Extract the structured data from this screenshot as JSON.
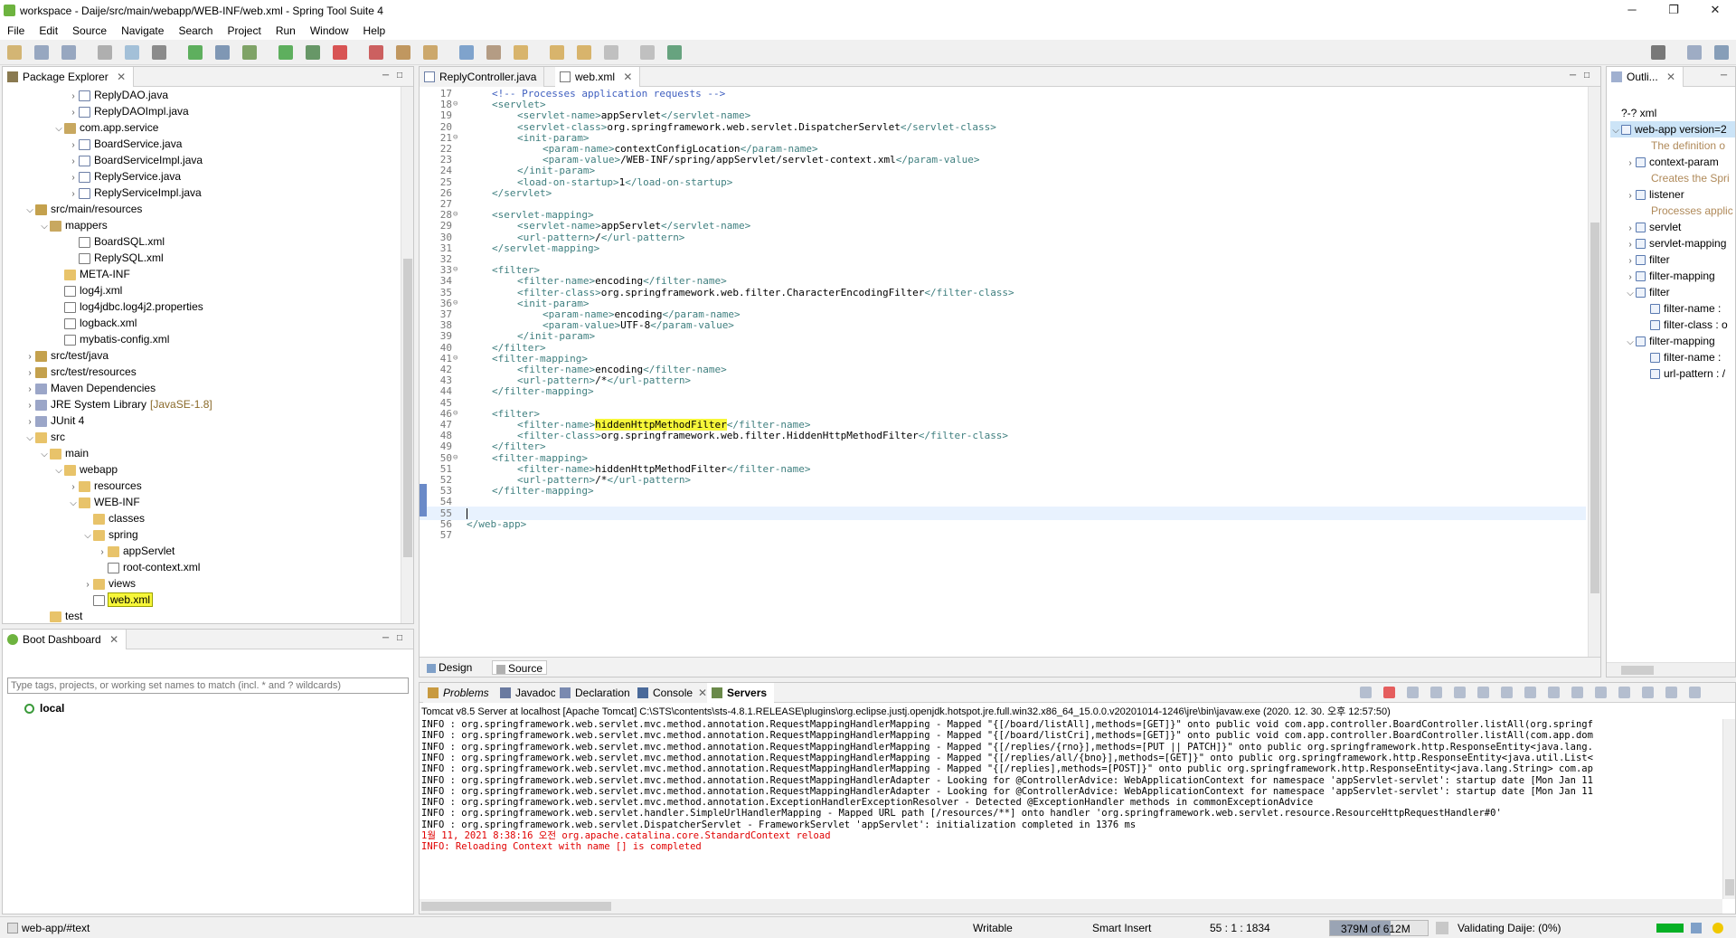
{
  "window": {
    "title": "workspace - Daije/src/main/webapp/WEB-INF/web.xml - Spring Tool Suite 4",
    "min_label": "─",
    "max_label": "❐",
    "close_label": "✕"
  },
  "menu": [
    "File",
    "Edit",
    "Source",
    "Navigate",
    "Search",
    "Project",
    "Run",
    "Window",
    "Help"
  ],
  "package_explorer": {
    "title": "Package Explorer",
    "items": [
      {
        "label": "ReplyDAO.java",
        "indent": 4,
        "twisty": ">",
        "icon": "java"
      },
      {
        "label": "ReplyDAOImpl.java",
        "indent": 4,
        "twisty": ">",
        "icon": "java"
      },
      {
        "label": "com.app.service",
        "indent": 3,
        "twisty": "v",
        "icon": "pkg"
      },
      {
        "label": "BoardService.java",
        "indent": 4,
        "twisty": ">",
        "icon": "java"
      },
      {
        "label": "BoardServiceImpl.java",
        "indent": 4,
        "twisty": ">",
        "icon": "java"
      },
      {
        "label": "ReplyService.java",
        "indent": 4,
        "twisty": ">",
        "icon": "java"
      },
      {
        "label": "ReplyServiceImpl.java",
        "indent": 4,
        "twisty": ">",
        "icon": "java"
      },
      {
        "label": "src/main/resources",
        "indent": 1,
        "twisty": "v",
        "icon": "src"
      },
      {
        "label": "mappers",
        "indent": 2,
        "twisty": "v",
        "icon": "pkg"
      },
      {
        "label": "BoardSQL.xml",
        "indent": 4,
        "twisty": "",
        "icon": "xml"
      },
      {
        "label": "ReplySQL.xml",
        "indent": 4,
        "twisty": "",
        "icon": "xml"
      },
      {
        "label": "META-INF",
        "indent": 3,
        "twisty": "",
        "icon": "folder"
      },
      {
        "label": "log4j.xml",
        "indent": 3,
        "twisty": "",
        "icon": "xml"
      },
      {
        "label": "log4jdbc.log4j2.properties",
        "indent": 3,
        "twisty": "",
        "icon": "xml"
      },
      {
        "label": "logback.xml",
        "indent": 3,
        "twisty": "",
        "icon": "xml"
      },
      {
        "label": "mybatis-config.xml",
        "indent": 3,
        "twisty": "",
        "icon": "xml"
      },
      {
        "label": "src/test/java",
        "indent": 1,
        "twisty": ">",
        "icon": "src"
      },
      {
        "label": "src/test/resources",
        "indent": 1,
        "twisty": ">",
        "icon": "src"
      },
      {
        "label": "Maven Dependencies",
        "indent": 1,
        "twisty": ">",
        "icon": "lib"
      },
      {
        "label": "JRE System Library",
        "suffix": "[JavaSE-1.8]",
        "indent": 1,
        "twisty": ">",
        "icon": "lib"
      },
      {
        "label": "JUnit 4",
        "indent": 1,
        "twisty": ">",
        "icon": "lib"
      },
      {
        "label": "src",
        "indent": 1,
        "twisty": "v",
        "icon": "folder"
      },
      {
        "label": "main",
        "indent": 2,
        "twisty": "v",
        "icon": "folder"
      },
      {
        "label": "webapp",
        "indent": 3,
        "twisty": "v",
        "icon": "folder"
      },
      {
        "label": "resources",
        "indent": 4,
        "twisty": ">",
        "icon": "folder"
      },
      {
        "label": "WEB-INF",
        "indent": 4,
        "twisty": "v",
        "icon": "folder"
      },
      {
        "label": "classes",
        "indent": 5,
        "twisty": "",
        "icon": "folder"
      },
      {
        "label": "spring",
        "indent": 5,
        "twisty": "v",
        "icon": "folder"
      },
      {
        "label": "appServlet",
        "indent": 6,
        "twisty": ">",
        "icon": "folder"
      },
      {
        "label": "root-context.xml",
        "indent": 6,
        "twisty": "",
        "icon": "xml"
      },
      {
        "label": "views",
        "indent": 5,
        "twisty": ">",
        "icon": "folder"
      },
      {
        "label": "web.xml",
        "indent": 5,
        "twisty": "",
        "icon": "xml",
        "selected": true
      },
      {
        "label": "test",
        "indent": 2,
        "twisty": "",
        "icon": "folder"
      }
    ]
  },
  "boot_dashboard": {
    "title": "Boot Dashboard",
    "search_placeholder": "Type tags, projects, or working set names to match (incl. * and ? wildcards)",
    "items": [
      "local"
    ]
  },
  "editor": {
    "tabs": [
      "ReplyController.java",
      "web.xml"
    ],
    "active_tab": 1,
    "bottom_tabs": [
      "Design",
      "Source"
    ],
    "lines": [
      {
        "n": "17",
        "fold": "",
        "indent": 1,
        "parts": [
          [
            "cmt",
            "<!-- Processes application requests -->"
          ]
        ]
      },
      {
        "n": "18",
        "fold": "⊖",
        "indent": 1,
        "parts": [
          [
            "tag",
            "<servlet>"
          ]
        ]
      },
      {
        "n": "19",
        "fold": "",
        "indent": 2,
        "parts": [
          [
            "tag",
            "<servlet-name>"
          ],
          [
            "txt",
            "appServlet"
          ],
          [
            "tag",
            "</servlet-name>"
          ]
        ]
      },
      {
        "n": "20",
        "fold": "",
        "indent": 2,
        "parts": [
          [
            "tag",
            "<servlet-class>"
          ],
          [
            "txt",
            "org.springframework.web.servlet.DispatcherServlet"
          ],
          [
            "tag",
            "</servlet-class>"
          ]
        ]
      },
      {
        "n": "21",
        "fold": "⊖",
        "indent": 2,
        "parts": [
          [
            "tag",
            "<init-param>"
          ]
        ]
      },
      {
        "n": "22",
        "fold": "",
        "indent": 3,
        "parts": [
          [
            "tag",
            "<param-name>"
          ],
          [
            "txt",
            "contextConfigLocation"
          ],
          [
            "tag",
            "</param-name>"
          ]
        ]
      },
      {
        "n": "23",
        "fold": "",
        "indent": 3,
        "parts": [
          [
            "tag",
            "<param-value>"
          ],
          [
            "txt",
            "/WEB-INF/spring/appServlet/servlet-context.xml"
          ],
          [
            "tag",
            "</param-value>"
          ]
        ]
      },
      {
        "n": "24",
        "fold": "",
        "indent": 2,
        "parts": [
          [
            "tag",
            "</init-param>"
          ]
        ]
      },
      {
        "n": "25",
        "fold": "",
        "indent": 2,
        "parts": [
          [
            "tag",
            "<load-on-startup>"
          ],
          [
            "txt",
            "1"
          ],
          [
            "tag",
            "</load-on-startup>"
          ]
        ]
      },
      {
        "n": "26",
        "fold": "",
        "indent": 1,
        "parts": [
          [
            "tag",
            "</servlet>"
          ]
        ]
      },
      {
        "n": "27",
        "fold": "",
        "indent": 0,
        "parts": []
      },
      {
        "n": "28",
        "fold": "⊖",
        "indent": 1,
        "parts": [
          [
            "tag",
            "<servlet-mapping>"
          ]
        ]
      },
      {
        "n": "29",
        "fold": "",
        "indent": 2,
        "parts": [
          [
            "tag",
            "<servlet-name>"
          ],
          [
            "txt",
            "appServlet"
          ],
          [
            "tag",
            "</servlet-name>"
          ]
        ]
      },
      {
        "n": "30",
        "fold": "",
        "indent": 2,
        "parts": [
          [
            "tag",
            "<url-pattern>"
          ],
          [
            "txt",
            "/"
          ],
          [
            "tag",
            "</url-pattern>"
          ]
        ]
      },
      {
        "n": "31",
        "fold": "",
        "indent": 1,
        "parts": [
          [
            "tag",
            "</servlet-mapping>"
          ]
        ]
      },
      {
        "n": "32",
        "fold": "",
        "indent": 0,
        "parts": []
      },
      {
        "n": "33",
        "fold": "⊖",
        "indent": 1,
        "parts": [
          [
            "tag",
            "<filter>"
          ]
        ]
      },
      {
        "n": "34",
        "fold": "",
        "indent": 2,
        "parts": [
          [
            "tag",
            "<filter-name>"
          ],
          [
            "txt",
            "encoding"
          ],
          [
            "tag",
            "</filter-name>"
          ]
        ]
      },
      {
        "n": "35",
        "fold": "",
        "indent": 2,
        "parts": [
          [
            "tag",
            "<filter-class>"
          ],
          [
            "txt",
            "org.springframework.web.filter.CharacterEncodingFilter"
          ],
          [
            "tag",
            "</filter-class>"
          ]
        ]
      },
      {
        "n": "36",
        "fold": "⊖",
        "indent": 2,
        "parts": [
          [
            "tag",
            "<init-param>"
          ]
        ]
      },
      {
        "n": "37",
        "fold": "",
        "indent": 3,
        "parts": [
          [
            "tag",
            "<param-name>"
          ],
          [
            "txt",
            "encoding"
          ],
          [
            "tag",
            "</param-name>"
          ]
        ]
      },
      {
        "n": "38",
        "fold": "",
        "indent": 3,
        "parts": [
          [
            "tag",
            "<param-value>"
          ],
          [
            "txt",
            "UTF-8"
          ],
          [
            "tag",
            "</param-value>"
          ]
        ]
      },
      {
        "n": "39",
        "fold": "",
        "indent": 2,
        "parts": [
          [
            "tag",
            "</init-param>"
          ]
        ]
      },
      {
        "n": "40",
        "fold": "",
        "indent": 1,
        "parts": [
          [
            "tag",
            "</filter>"
          ]
        ]
      },
      {
        "n": "41",
        "fold": "⊖",
        "indent": 1,
        "parts": [
          [
            "tag",
            "<filter-mapping>"
          ]
        ]
      },
      {
        "n": "42",
        "fold": "",
        "indent": 2,
        "parts": [
          [
            "tag",
            "<filter-name>"
          ],
          [
            "txt",
            "encoding"
          ],
          [
            "tag",
            "</filter-name>"
          ]
        ]
      },
      {
        "n": "43",
        "fold": "",
        "indent": 2,
        "parts": [
          [
            "tag",
            "<url-pattern>"
          ],
          [
            "txt",
            "/*"
          ],
          [
            "tag",
            "</url-pattern>"
          ]
        ]
      },
      {
        "n": "44",
        "fold": "",
        "indent": 1,
        "parts": [
          [
            "tag",
            "</filter-mapping>"
          ]
        ]
      },
      {
        "n": "45",
        "fold": "",
        "indent": 0,
        "parts": []
      },
      {
        "n": "46",
        "fold": "⊖",
        "indent": 1,
        "parts": [
          [
            "tag",
            "<filter>"
          ]
        ]
      },
      {
        "n": "47",
        "fold": "",
        "indent": 2,
        "parts": [
          [
            "tag",
            "<filter-name>"
          ],
          [
            "hl",
            "hiddenHttpMethodFilter"
          ],
          [
            "tag",
            "</filter-name>"
          ]
        ]
      },
      {
        "n": "48",
        "fold": "",
        "indent": 2,
        "parts": [
          [
            "tag",
            "<filter-class>"
          ],
          [
            "txt",
            "org.springframework.web.filter.HiddenHttpMethodFilter"
          ],
          [
            "tag",
            "</filter-class>"
          ]
        ]
      },
      {
        "n": "49",
        "fold": "",
        "indent": 1,
        "parts": [
          [
            "tag",
            "</filter>"
          ]
        ]
      },
      {
        "n": "50",
        "fold": "⊖",
        "indent": 1,
        "parts": [
          [
            "tag",
            "<filter-mapping>"
          ]
        ]
      },
      {
        "n": "51",
        "fold": "",
        "indent": 2,
        "parts": [
          [
            "tag",
            "<filter-name>"
          ],
          [
            "txt",
            "hiddenHttpMethodFilter"
          ],
          [
            "tag",
            "</filter-name>"
          ]
        ]
      },
      {
        "n": "52",
        "fold": "",
        "indent": 2,
        "parts": [
          [
            "tag",
            "<url-pattern>"
          ],
          [
            "txt",
            "/*"
          ],
          [
            "tag",
            "</url-pattern>"
          ]
        ]
      },
      {
        "n": "53",
        "fold": "",
        "indent": 1,
        "parts": [
          [
            "tag",
            "</filter-mapping>"
          ]
        ]
      },
      {
        "n": "54",
        "fold": "",
        "indent": 0,
        "parts": []
      },
      {
        "n": "55",
        "fold": "",
        "indent": 0,
        "parts": [],
        "current": true
      },
      {
        "n": "56",
        "fold": "",
        "indent": 0,
        "parts": [
          [
            "tag",
            "</web-app>"
          ]
        ]
      },
      {
        "n": "57",
        "fold": "",
        "indent": 0,
        "parts": []
      }
    ]
  },
  "outline": {
    "title": "Outli...",
    "items": [
      {
        "label": "?-? xml",
        "indent": 0,
        "twisty": "",
        "style": "normal"
      },
      {
        "label": "web-app version=2",
        "indent": 0,
        "twisty": "v",
        "style": "selected"
      },
      {
        "label": "The definition o",
        "indent": 1,
        "twisty": "",
        "style": "comment"
      },
      {
        "label": "context-param",
        "indent": 1,
        "twisty": ">",
        "style": "normal"
      },
      {
        "label": "Creates the Spri",
        "indent": 1,
        "twisty": "",
        "style": "comment"
      },
      {
        "label": "listener",
        "indent": 1,
        "twisty": ">",
        "style": "normal"
      },
      {
        "label": "Processes applic",
        "indent": 1,
        "twisty": "",
        "style": "comment"
      },
      {
        "label": "servlet",
        "indent": 1,
        "twisty": ">",
        "style": "normal"
      },
      {
        "label": "servlet-mapping",
        "indent": 1,
        "twisty": ">",
        "style": "normal"
      },
      {
        "label": "filter",
        "indent": 1,
        "twisty": ">",
        "style": "normal"
      },
      {
        "label": "filter-mapping",
        "indent": 1,
        "twisty": ">",
        "style": "normal"
      },
      {
        "label": "filter",
        "indent": 1,
        "twisty": "v",
        "style": "normal"
      },
      {
        "label": "filter-name :",
        "indent": 2,
        "twisty": "",
        "style": "normal"
      },
      {
        "label": "filter-class : o",
        "indent": 2,
        "twisty": "",
        "style": "normal"
      },
      {
        "label": "filter-mapping",
        "indent": 1,
        "twisty": "v",
        "style": "normal"
      },
      {
        "label": "filter-name :",
        "indent": 2,
        "twisty": "",
        "style": "normal"
      },
      {
        "label": "url-pattern : /",
        "indent": 2,
        "twisty": "",
        "style": "normal"
      }
    ]
  },
  "console": {
    "tabs": [
      "Problems",
      "Javadoc",
      "Declaration",
      "Console",
      "Servers"
    ],
    "header": "Tomcat v8.5 Server at localhost [Apache Tomcat] C:\\STS\\contents\\sts-4.8.1.RELEASE\\plugins\\org.eclipse.justj.openjdk.hotspot.jre.full.win32.x86_64_15.0.0.v20201014-1246\\jre\\bin\\javaw.exe  (2020. 12. 30. 오후 12:57:50)",
    "lines": [
      {
        "t": "INFO : org.springframework.web.servlet.mvc.method.annotation.RequestMappingHandlerMapping - Mapped \"{[/board/listAll],methods=[GET]}\" onto public void com.app.controller.BoardController.listAll(org.springf",
        "c": "black"
      },
      {
        "t": "INFO : org.springframework.web.servlet.mvc.method.annotation.RequestMappingHandlerMapping - Mapped \"{[/board/listCri],methods=[GET]}\" onto public void com.app.controller.BoardController.listAll(com.app.dom",
        "c": "black"
      },
      {
        "t": "INFO : org.springframework.web.servlet.mvc.method.annotation.RequestMappingHandlerMapping - Mapped \"{[/replies/{rno}],methods=[PUT || PATCH]}\" onto public org.springframework.http.ResponseEntity<java.lang.",
        "c": "black"
      },
      {
        "t": "INFO : org.springframework.web.servlet.mvc.method.annotation.RequestMappingHandlerMapping - Mapped \"{[/replies/all/{bno}],methods=[GET]}\" onto public org.springframework.http.ResponseEntity<java.util.List<",
        "c": "black"
      },
      {
        "t": "INFO : org.springframework.web.servlet.mvc.method.annotation.RequestMappingHandlerMapping - Mapped \"{[/replies],methods=[POST]}\" onto public org.springframework.http.ResponseEntity<java.lang.String> com.ap",
        "c": "black"
      },
      {
        "t": "INFO : org.springframework.web.servlet.mvc.method.annotation.RequestMappingHandlerAdapter - Looking for @ControllerAdvice: WebApplicationContext for namespace 'appServlet-servlet': startup date [Mon Jan 11",
        "c": "black"
      },
      {
        "t": "INFO : org.springframework.web.servlet.mvc.method.annotation.RequestMappingHandlerAdapter - Looking for @ControllerAdvice: WebApplicationContext for namespace 'appServlet-servlet': startup date [Mon Jan 11",
        "c": "black"
      },
      {
        "t": "INFO : org.springframework.web.servlet.mvc.method.annotation.ExceptionHandlerExceptionResolver - Detected @ExceptionHandler methods in commonExceptionAdvice",
        "c": "black"
      },
      {
        "t": "INFO : org.springframework.web.servlet.handler.SimpleUrlHandlerMapping - Mapped URL path [/resources/**] onto handler 'org.springframework.web.servlet.resource.ResourceHttpRequestHandler#0'",
        "c": "black"
      },
      {
        "t": "INFO : org.springframework.web.servlet.DispatcherServlet - FrameworkServlet 'appServlet': initialization completed in 1376 ms",
        "c": "black"
      },
      {
        "t": "1월 11, 2021 8:38:16 오전 org.apache.catalina.core.StandardContext reload",
        "c": "red"
      },
      {
        "t": "INFO: Reloading Context with name [] is completed",
        "c": "red"
      }
    ]
  },
  "status": {
    "path": "web-app/#text",
    "writable": "Writable",
    "insert_mode": "Smart Insert",
    "position": "55 : 1 : 1834",
    "memory": "379M of 612M",
    "memory_fraction": 0.62,
    "task": "Validating Daije: (0%)"
  },
  "colors": {
    "tag": "#3f7f7f",
    "comment": "#3f5fbf",
    "highlight": "#f7f73a",
    "console_red": "#e00000"
  }
}
